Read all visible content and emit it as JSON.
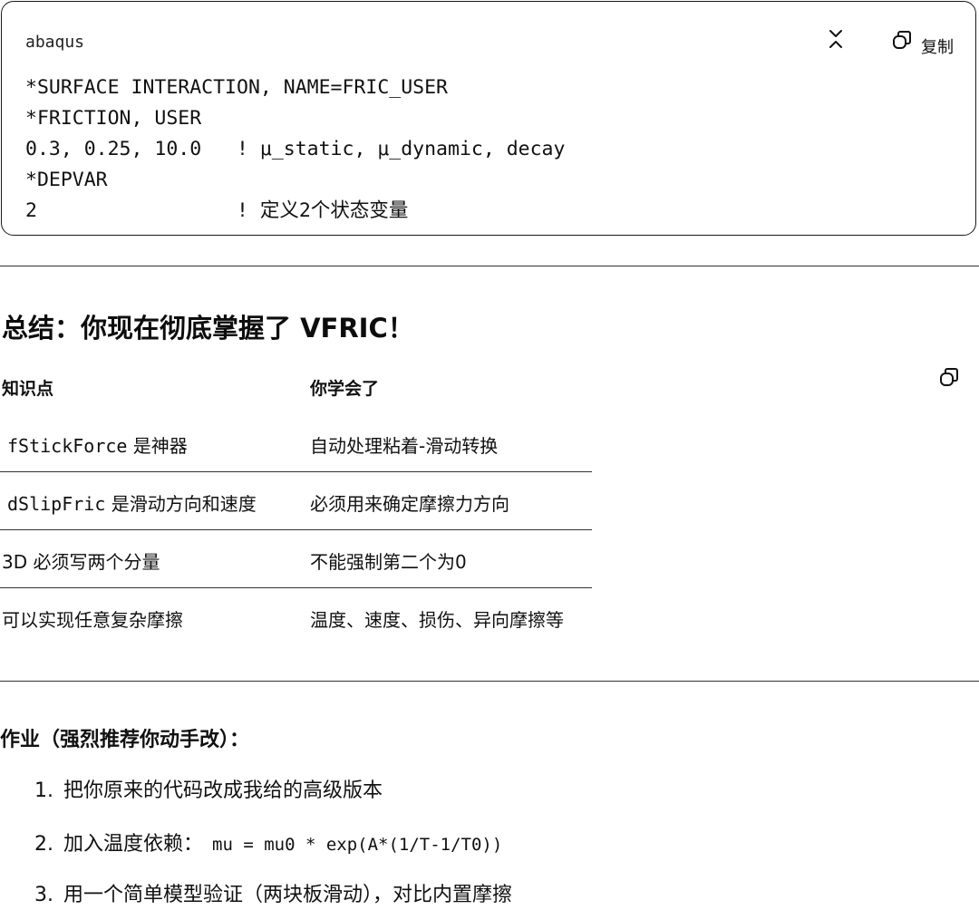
{
  "code_block": {
    "language": "abaqus",
    "copy_label": "复制",
    "lines": [
      {
        "code": "*SURFACE INTERACTION, NAME=FRIC_USER",
        "comment": ""
      },
      {
        "code": "*FRICTION, USER",
        "comment": ""
      },
      {
        "code": "0.3, 0.25, 10.0   ",
        "comment": "! μ_static, μ_dynamic, decay"
      },
      {
        "code": "*DEPVAR",
        "comment": ""
      },
      {
        "code": "2                 ",
        "comment": "! 定义2个状态变量"
      }
    ]
  },
  "summary": {
    "title": "总结：你现在彻底掌握了 VFRIC！",
    "headers": [
      "知识点",
      "你学会了"
    ],
    "rows": [
      {
        "point_code": "fStickForce",
        "point_text": " 是神器",
        "learned": "自动处理粘着-滑动转换"
      },
      {
        "point_code": "dSlipFric",
        "point_text": " 是滑动方向和速度",
        "learned": "必须用来确定摩擦力方向"
      },
      {
        "point_code": "",
        "point_text": "3D 必须写两个分量",
        "learned": "不能强制第二个为0"
      },
      {
        "point_code": "",
        "point_text": "可以实现任意复杂摩擦",
        "learned": "温度、速度、损伤、异向摩擦等"
      }
    ]
  },
  "homework": {
    "title": "作业（强烈推荐你动手改）：",
    "items": [
      {
        "num": "1.",
        "text": "把你原来的代码改成我给的高级版本",
        "code": ""
      },
      {
        "num": "2.",
        "text": "加入温度依赖：",
        "code": "mu = mu0 * exp(A*(1/T-1/T0))"
      },
      {
        "num": "3.",
        "text": "用一个简单模型验证（两块板滑动），对比内置摩擦",
        "code": ""
      }
    ]
  },
  "icons": {
    "collapse": "collapse-icon",
    "copy": "copy-icon"
  }
}
